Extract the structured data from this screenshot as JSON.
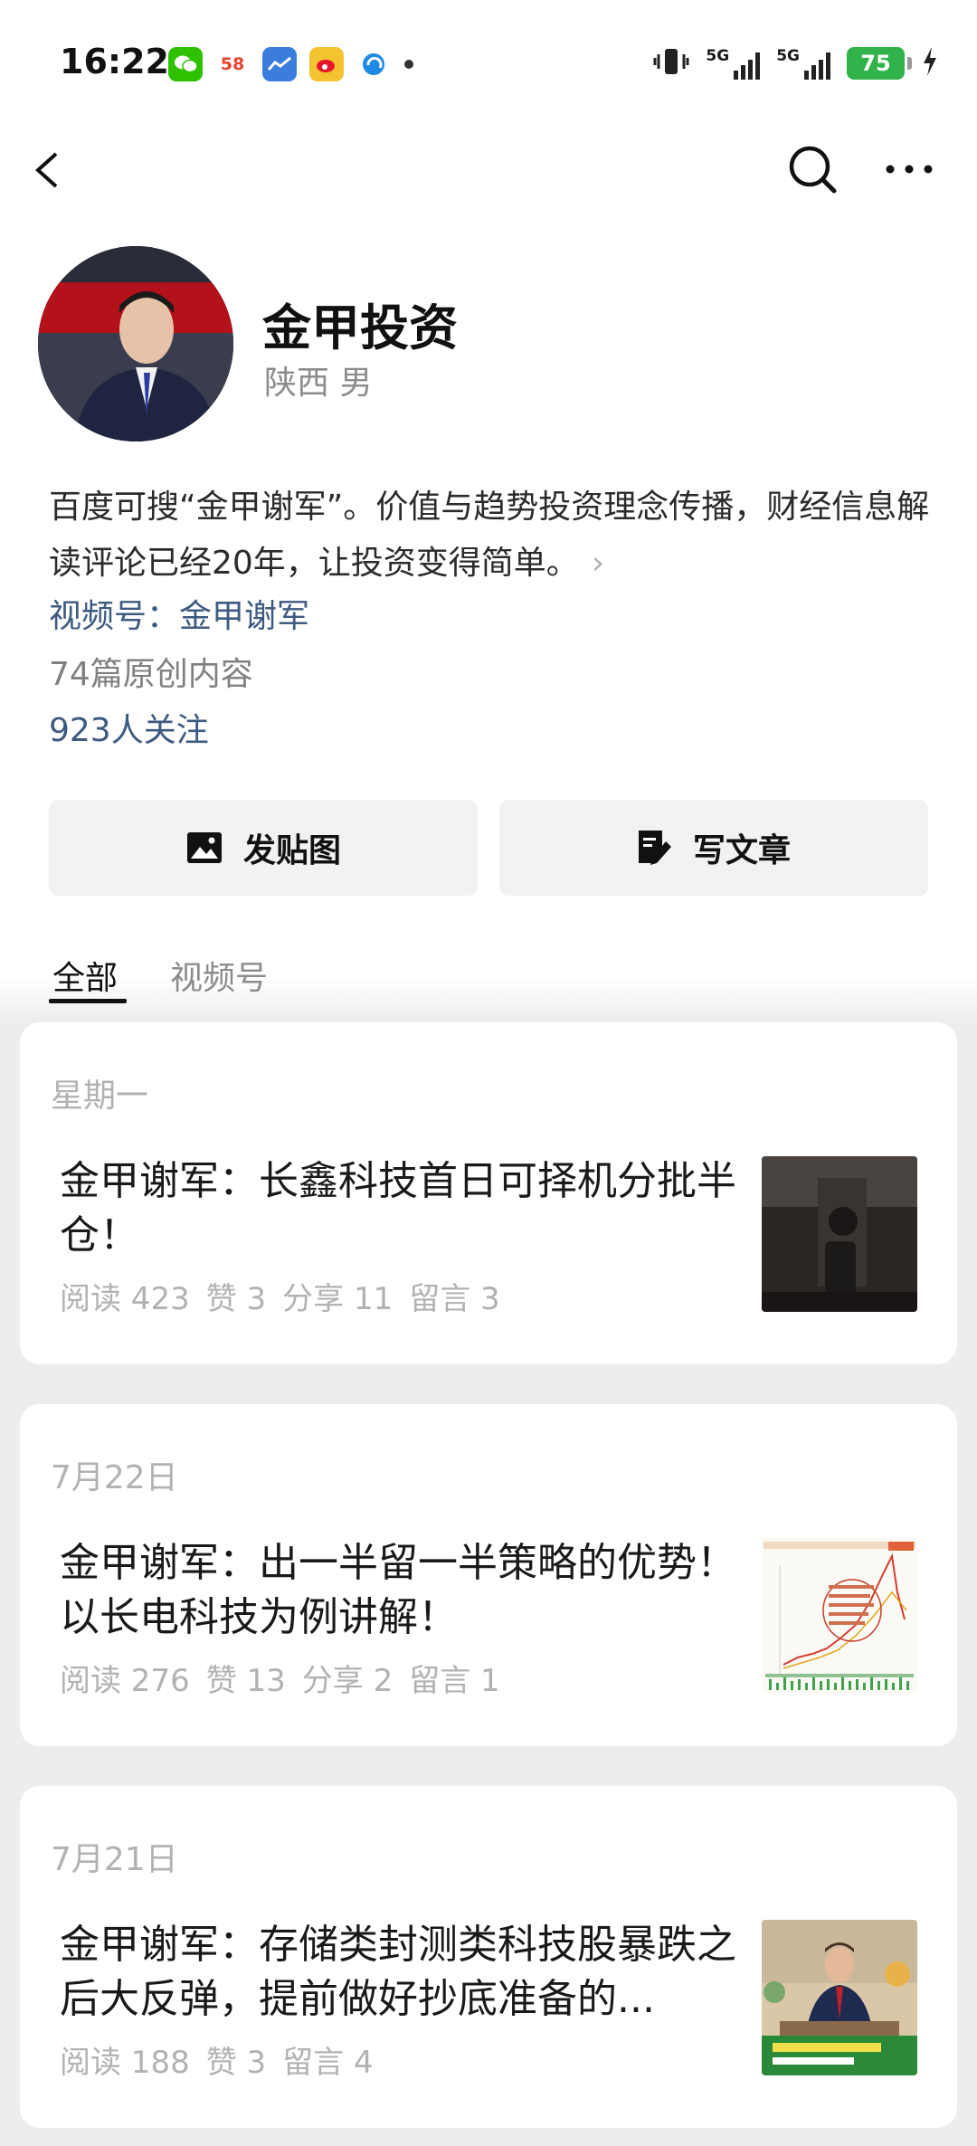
{
  "status_bar": {
    "time": "16:22",
    "notifications": [
      "wechat-icon",
      "58-app-icon",
      "stock-chart-app-icon",
      "weibo-icon",
      "browser-icon",
      "more-dot-icon"
    ],
    "notif_58_label": "58",
    "network_1": "5G",
    "network_2": "5G",
    "battery": "75"
  },
  "profile": {
    "name": "金甲投资",
    "meta": "陕西 男",
    "bio": "百度可搜“金甲谢军”。价值与趋势投资理念传播，财经信息解读评论已经20年，让投资变得简单。",
    "bio_chevron": "›",
    "channel_label": "视频号：",
    "channel_name": "金甲谢军",
    "original_count": "74篇原创内容",
    "followers": "923人关注"
  },
  "actions": {
    "post_image": "发贴图",
    "write_article": "写文章"
  },
  "tabs": [
    {
      "label": "全部",
      "active": true
    },
    {
      "label": "视频号",
      "active": false
    }
  ],
  "articles": [
    {
      "date": "星期一",
      "title": "金甲谢军：长鑫科技首日可择机分批半仓！",
      "reads": "阅读 423",
      "likes": "赞 3",
      "shares": "分享 11",
      "comments": "留言 3"
    },
    {
      "date": "7月22日",
      "title": "金甲谢军：出一半留一半策略的优势！以长电科技为例讲解！",
      "reads": "阅读 276",
      "likes": "赞 13",
      "shares": "分享 2",
      "comments": "留言 1"
    },
    {
      "date": "7月21日",
      "title": "金甲谢军：存储类封测类科技股暴跌之后大反弹，提前做好抄底准备的...",
      "reads": "阅读 188",
      "likes": "赞 3",
      "comments": "留言 4"
    }
  ],
  "colors": {
    "link": "#3d5a80",
    "secondary": "#8c8c8c",
    "muted": "#b2b2b2",
    "battery": "#2fb34a"
  }
}
